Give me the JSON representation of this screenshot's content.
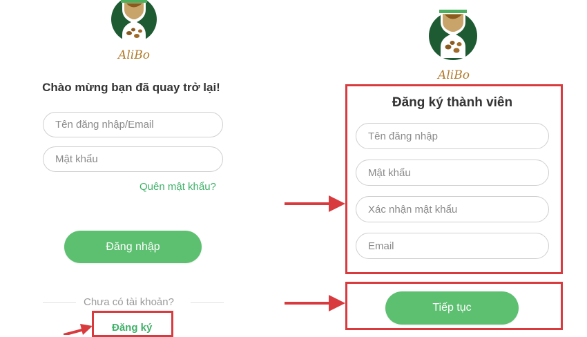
{
  "login": {
    "brand": "AliBo",
    "heading": "Chào mừng bạn đã quay trở lại!",
    "username_placeholder": "Tên đăng nhập/Email",
    "password_placeholder": "Mật khẩu",
    "forgot_link": "Quên mật khẩu?",
    "login_button": "Đăng nhập",
    "no_account_text": "Chưa có tài khoản?",
    "register_link": "Đăng ký"
  },
  "register": {
    "brand": "AliBo",
    "heading": "Đăng ký thành viên",
    "username_placeholder": "Tên đăng nhập",
    "password_placeholder": "Mật khẩu",
    "confirm_placeholder": "Xác nhận mật khẩu",
    "email_placeholder": "Email",
    "continue_button": "Tiếp tục"
  },
  "colors": {
    "accent_green": "#5cc070",
    "link_green": "#3fb168",
    "highlight_red": "#d93a3d",
    "logo_dark_green": "#1e5a32",
    "logo_brown": "#b07a2a"
  },
  "icons": [
    "alibo-logo-icon",
    "red-arrow-icon"
  ]
}
